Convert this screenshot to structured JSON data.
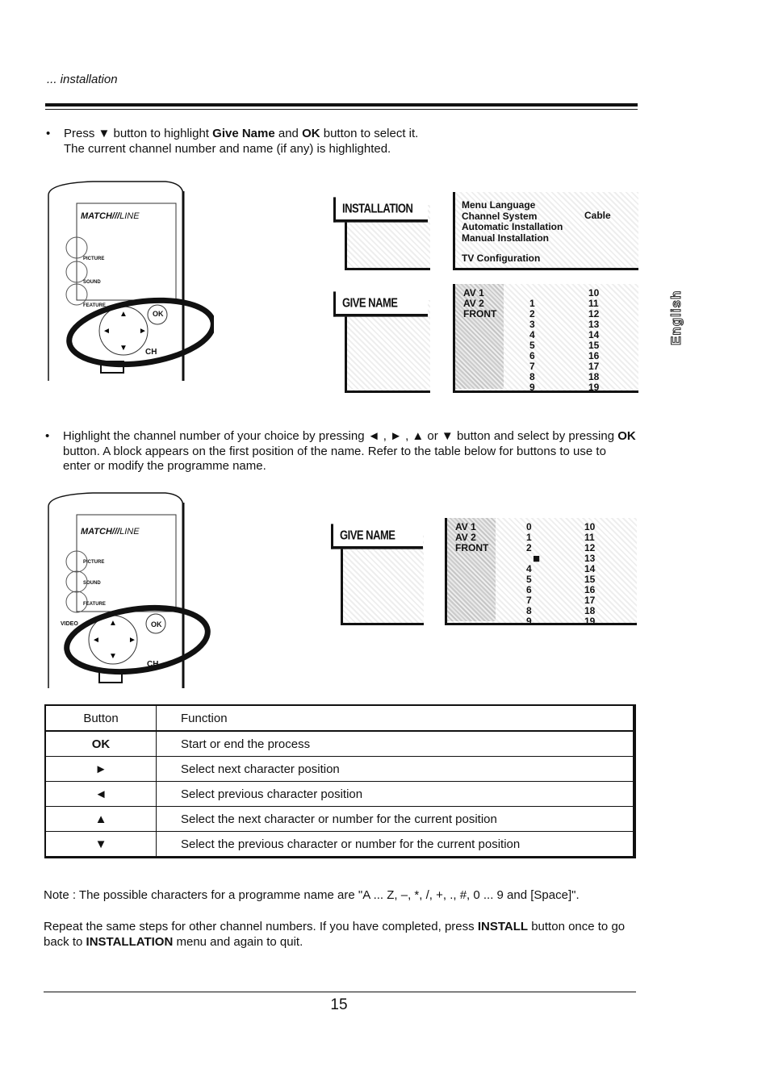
{
  "header": {
    "section": "... installation"
  },
  "step1": {
    "press": "Press",
    "arrow_down": "▼",
    "text1": "button to highlight",
    "give_name": "Give Name",
    "and": "and",
    "ok": "OK",
    "text2": "button to select it.",
    "line2": "The current channel number and name (if any) is highlighted."
  },
  "remote": {
    "brand": "MATCH",
    "brand_suffix": "LINE",
    "buttons": [
      "PICTURE",
      "SOUND",
      "FEATURE"
    ],
    "video": "VIDEO",
    "ok": "OK",
    "ch": "CH"
  },
  "menu_install": {
    "title": "INSTALLATION",
    "items": [
      "Menu Language",
      "Channel System",
      "Automatic Installation",
      "Manual Installation",
      "TV Configuration"
    ],
    "channel_system_value": "Cable"
  },
  "menu_givename1": {
    "title": "GIVE NAME",
    "col1": [
      "AV 1",
      "AV 2",
      "FRONT"
    ],
    "col2": [
      "",
      "1",
      "2",
      "3",
      "4",
      "5",
      "6",
      "7",
      "8",
      "9"
    ],
    "col3": [
      "10",
      "11",
      "12",
      "13",
      "14",
      "15",
      "16",
      "17",
      "18",
      "19"
    ]
  },
  "step2": {
    "text": "Highlight the channel number of your choice by pressing ◄ , ► , ▲ or ▼ button and select by pressing",
    "ok": "OK",
    "text2": "button. A block appears on the first position of the name. Refer to the table below for buttons to use to enter or modify the programme name."
  },
  "menu_givename2": {
    "title": "GIVE NAME",
    "col1": [
      "AV 1",
      "AV 2",
      "FRONT"
    ],
    "col2": [
      "0",
      "1",
      "2",
      "■",
      "4",
      "5",
      "6",
      "7",
      "8",
      "9"
    ],
    "col3": [
      "10",
      "11",
      "12",
      "13",
      "14",
      "15",
      "16",
      "17",
      "18",
      "19"
    ]
  },
  "table": {
    "headers": [
      "Button",
      "Function"
    ],
    "rows": [
      [
        "OK",
        "Start or end the process"
      ],
      [
        "►",
        "Select next character position"
      ],
      [
        "◄",
        "Select previous character position"
      ],
      [
        "▲",
        "Select the next character or number for the current position"
      ],
      [
        "▼",
        "Select the previous character or number for the current position"
      ]
    ]
  },
  "note": "Note : The possible characters for a programme name are \"A ... Z, –, *, /, +, ., #, 0 ... 9 and [Space]\".",
  "repeat": {
    "t1": "Repeat the same steps for other channel numbers. If you have completed, press",
    "install": "INSTALL",
    "t2": "button once to go back to",
    "installation": "INSTALLATION",
    "t3": "menu and again to quit."
  },
  "side_tab": "English",
  "page_number": "15"
}
